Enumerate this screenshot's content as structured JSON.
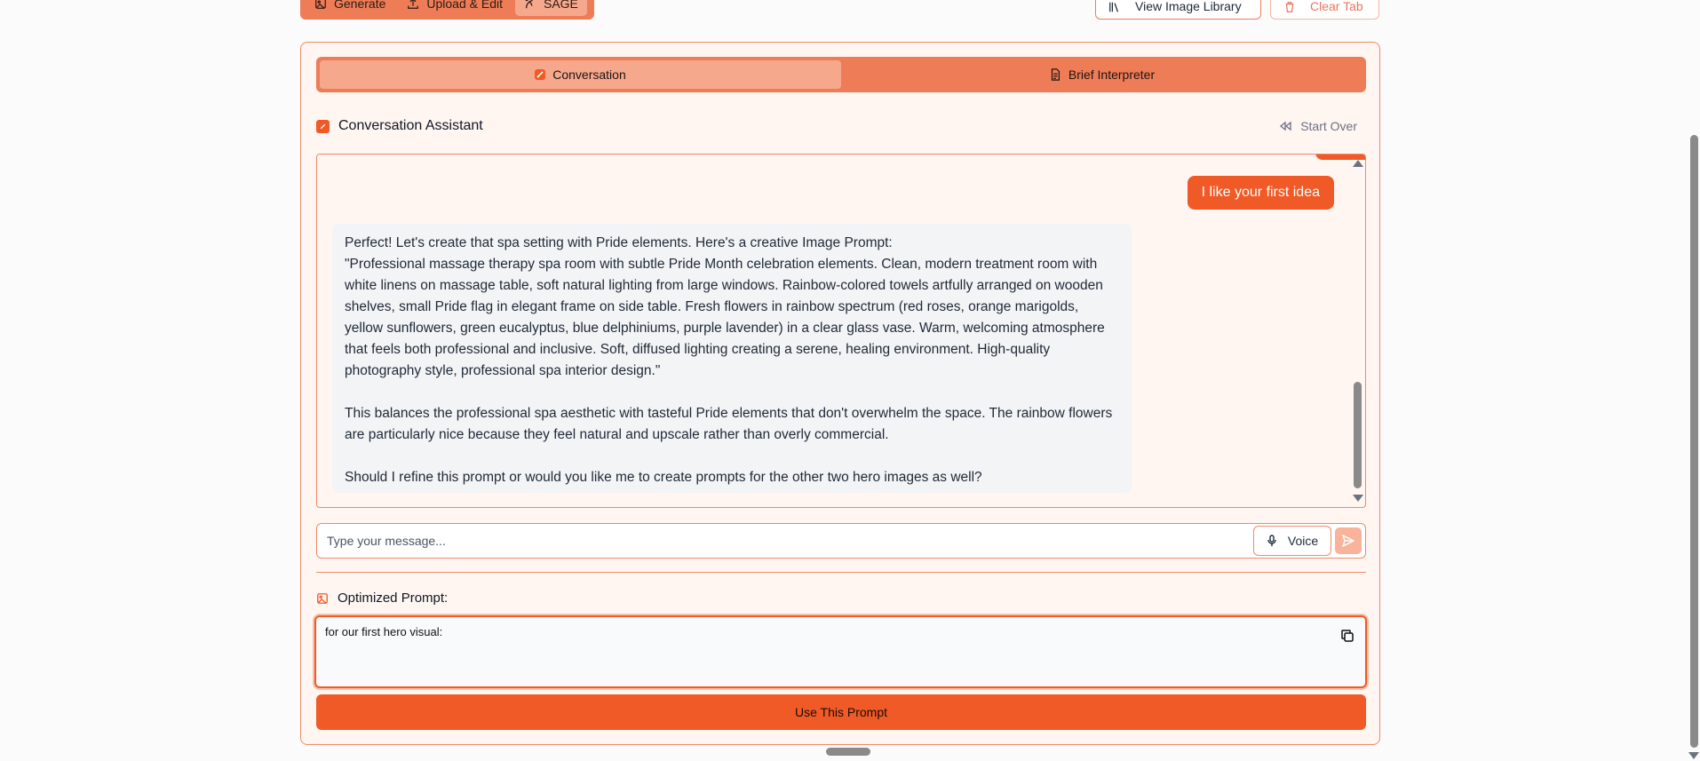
{
  "toolbar": {
    "tabs": [
      {
        "label": "Generate",
        "icon": "image-icon"
      },
      {
        "label": "Upload & Edit",
        "icon": "upload-icon"
      },
      {
        "label": "SAGE",
        "icon": "sage-icon"
      }
    ],
    "active_tab": "SAGE",
    "library_label": "View Image Library",
    "clear_label": "Clear Tab"
  },
  "mode_tabs": [
    {
      "label": "Conversation",
      "icon": "chat-icon",
      "active": true
    },
    {
      "label": "Brief Interpreter",
      "icon": "document-icon",
      "active": false
    }
  ],
  "assistant": {
    "title": "Conversation Assistant",
    "start_over_label": "Start Over"
  },
  "messages": {
    "user": "I like your first idea",
    "assistant_paragraphs": [
      "Perfect! Let's create that spa setting with Pride elements. Here's a creative Image Prompt:",
      "\"Professional massage therapy spa room with subtle Pride Month celebration elements. Clean, modern treatment room with white linens on massage table, soft natural lighting from large windows. Rainbow-colored towels artfully arranged on wooden shelves, small Pride flag in elegant frame on side table. Fresh flowers in rainbow spectrum (red roses, orange marigolds, yellow sunflowers, green eucalyptus, blue delphiniums, purple lavender) in a clear glass vase. Warm, welcoming atmosphere that feels both professional and inclusive. Soft, diffused lighting creating a serene, healing environment. High-quality photography style, professional spa interior design.\"",
      "This balances the professional spa aesthetic with tasteful Pride elements that don't overwhelm the space. The rainbow flowers are particularly nice because they feel natural and upscale rather than overly commercial.",
      "Should I refine this prompt or would you like me to create prompts for the other two hero images as well?"
    ]
  },
  "input": {
    "placeholder": "Type your message...",
    "voice_label": "Voice"
  },
  "optimized": {
    "label": "Optimized Prompt:",
    "value": "for our first hero visual:",
    "use_label": "Use This Prompt"
  },
  "colors": {
    "accent": "#f05a26",
    "tab_bar": "#ee7d57",
    "tab_active": "#f6a88d",
    "card_bg": "#fff5f1"
  }
}
